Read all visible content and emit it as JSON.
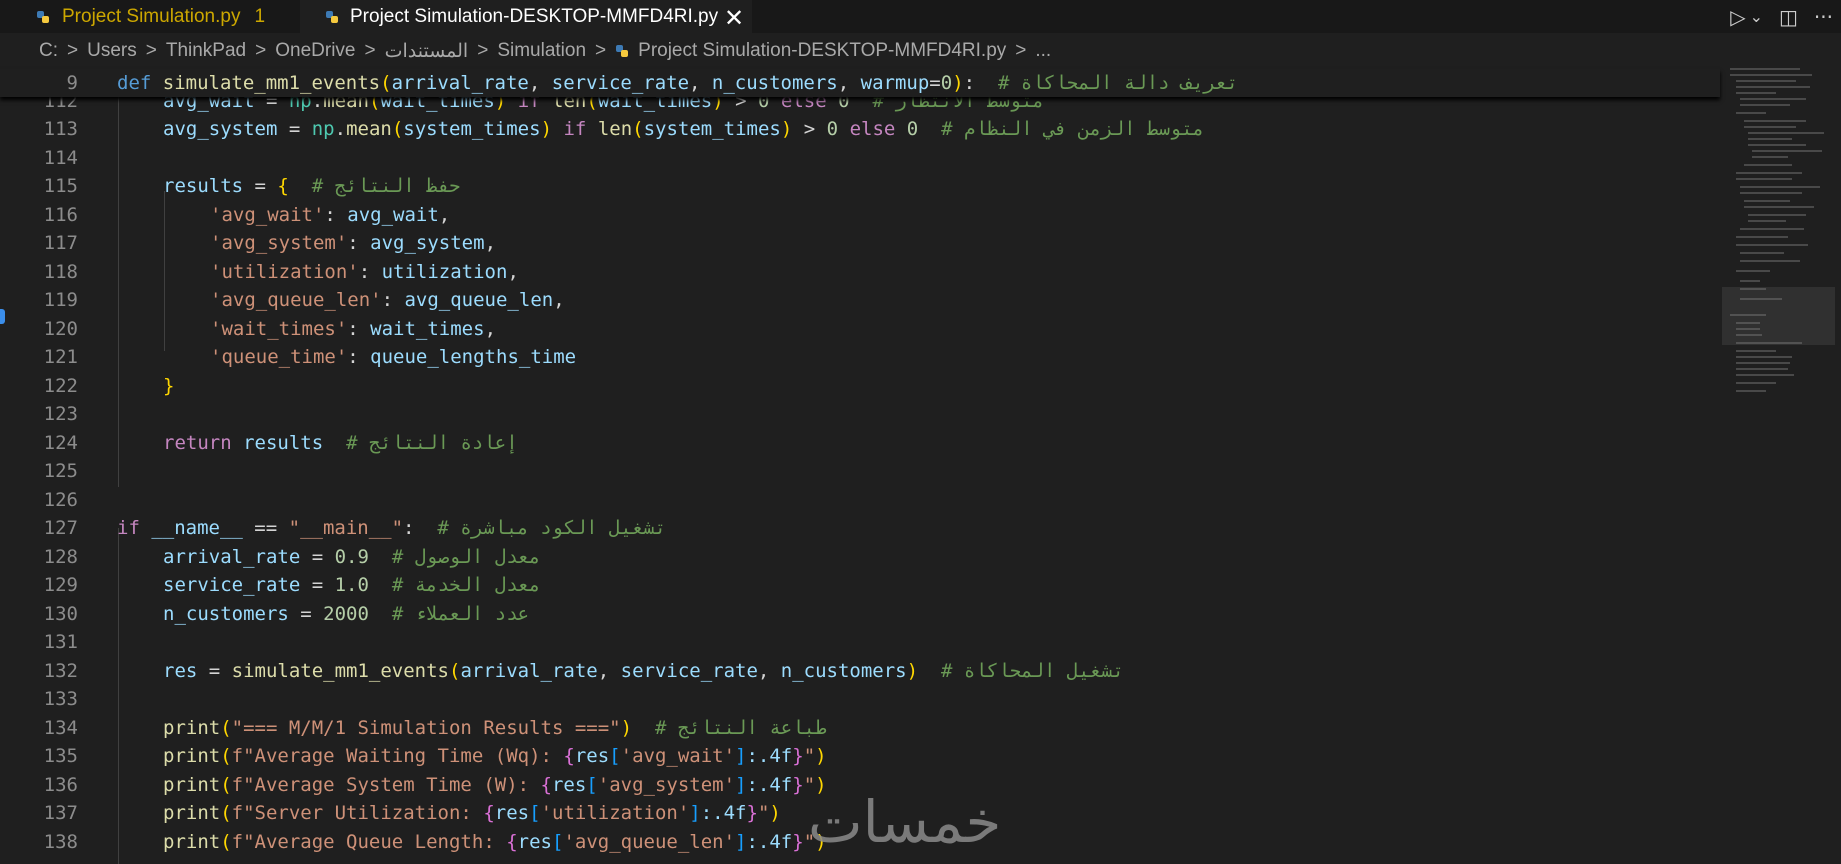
{
  "tabs": [
    {
      "label": "Project Simulation.py",
      "badge": "1",
      "active": false
    },
    {
      "label": "Project Simulation-DESKTOP-MMFD4RI.py",
      "close": "✕",
      "active": true
    }
  ],
  "actions": {
    "run": "▷",
    "run_dropdown": "⌄",
    "split": "◫",
    "more": "···"
  },
  "breadcrumb": {
    "items": [
      "C:",
      "Users",
      "ThinkPad",
      "OneDrive",
      "المستندات",
      "Simulation"
    ],
    "file": "Project Simulation-DESKTOP-MMFD4RI.py",
    "more": "...",
    "separator": ">"
  },
  "sticky_line": {
    "number": "9"
  },
  "line_numbers": [
    "112",
    "113",
    "114",
    "115",
    "116",
    "117",
    "118",
    "119",
    "120",
    "121",
    "122",
    "123",
    "124",
    "125",
    "126",
    "127",
    "128",
    "129",
    "130",
    "131",
    "132",
    "133",
    "134",
    "135",
    "136",
    "137",
    "138"
  ],
  "code": {
    "l9": {
      "def": "def",
      "fn": "simulate_mm1_events",
      "p1": "arrival_rate",
      "p2": "service_rate",
      "p3": "n_customers",
      "p4": "warmup",
      "v4": "0",
      "comment": "# تعريف دالة المحاكاة"
    },
    "l112": {
      "var": "avg_wait",
      "np": "np",
      "fn": "mean",
      "arg": "wait_times",
      "kw_if": "if",
      "len": "len",
      "arg2": "wait_times",
      "num": "0",
      "kw_else": "else",
      "num2": "0",
      "comment": "# متوسط الانتظار"
    },
    "l113": {
      "var": "avg_system",
      "np": "np",
      "fn": "mean",
      "arg": "system_times",
      "kw_if": "if",
      "len": "len",
      "arg2": "system_times",
      "num": "0",
      "kw_else": "else",
      "num2": "0",
      "comment": "# متوسط الزمن في النظام"
    },
    "l115": {
      "var": "results",
      "comment": "# حفظ النتائج"
    },
    "l116": {
      "key": "'avg_wait'",
      "val": "avg_wait"
    },
    "l117": {
      "key": "'avg_system'",
      "val": "avg_system"
    },
    "l118": {
      "key": "'utilization'",
      "val": "utilization"
    },
    "l119": {
      "key": "'avg_queue_len'",
      "val": "avg_queue_len"
    },
    "l120": {
      "key": "'wait_times'",
      "val": "wait_times"
    },
    "l121": {
      "key": "'queue_time'",
      "val": "queue_lengths_time"
    },
    "l124": {
      "kw": "return",
      "var": "results",
      "comment": "# إعادة النتائج"
    },
    "l127": {
      "kw": "if",
      "name": "__name__",
      "str": "\"__main__\"",
      "comment": "# تشغيل الكود مباشرة"
    },
    "l128": {
      "var": "arrival_rate",
      "num": "0.9",
      "comment": "# معدل الوصول"
    },
    "l129": {
      "var": "service_rate",
      "num": "1.0",
      "comment": "# معدل الخدمة"
    },
    "l130": {
      "var": "n_customers",
      "num": "2000",
      "comment": "# عدد العملاء"
    },
    "l132": {
      "var": "res",
      "fn": "simulate_mm1_events",
      "a1": "arrival_rate",
      "a2": "service_rate",
      "a3": "n_customers",
      "comment": "# تشغيل المحاكاة"
    },
    "l134": {
      "fn": "print",
      "str": "\"=== M/M/1 Simulation Results ===\"",
      "comment": "# طباعة النتائج"
    },
    "l135": {
      "fn": "print",
      "pre": "f\"Average Waiting Time (Wq): ",
      "var": "res",
      "key": "'avg_wait'",
      "fmt": ":.4f",
      "end": "\""
    },
    "l136": {
      "fn": "print",
      "pre": "f\"Average System Time (W): ",
      "var": "res",
      "key": "'avg_system'",
      "fmt": ":.4f",
      "end": "\""
    },
    "l137": {
      "fn": "print",
      "pre": "f\"Server Utilization: ",
      "var": "res",
      "key": "'utilization'",
      "fmt": ":.4f",
      "end": "\""
    },
    "l138": {
      "fn": "print",
      "pre": "f\"Average Queue Length: ",
      "var": "res",
      "key": "'avg_queue_len'",
      "fmt": ":.4f",
      "end": "\""
    }
  },
  "watermark": "خمسات",
  "colors": {
    "keyword": "#c586c0",
    "function": "#dcdcaa",
    "variable": "#9cdcfe",
    "string": "#ce9178",
    "number": "#b5cea8",
    "comment": "#6a9955",
    "bracket": "#ffd700",
    "modified_tab": "#cca700"
  }
}
